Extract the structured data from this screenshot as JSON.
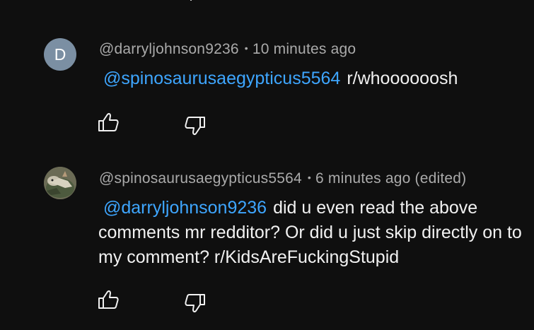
{
  "comments": [
    {
      "avatar_letter": "D",
      "avatar_color": "#7b8fa3",
      "author": "@darryljohnson9236",
      "separator": "•",
      "time": "10 minutes ago",
      "mention": "@spinosaurusaegypticus5564",
      "text": "r/whoooooosh",
      "like_icon": "thumbs-up-icon",
      "dislike_icon": "thumbs-down-icon"
    },
    {
      "avatar_description_icon": "dinosaur-avatar-icon",
      "author": "@spinosaurusaegypticus5564",
      "separator": "•",
      "time": "6 minutes ago (edited)",
      "mention": "@darryljohnson9236",
      "text": "did u even read the above comments mr redditor? Or did u just skip directly on to my comment? r/KidsAreFuckingStupid",
      "like_icon": "thumbs-up-icon",
      "dislike_icon": "thumbs-down-icon"
    }
  ],
  "colors": {
    "background": "#0f0f0f",
    "text": "#f1f1f1",
    "meta": "#aaaaaa",
    "mention": "#3ea6ff"
  }
}
